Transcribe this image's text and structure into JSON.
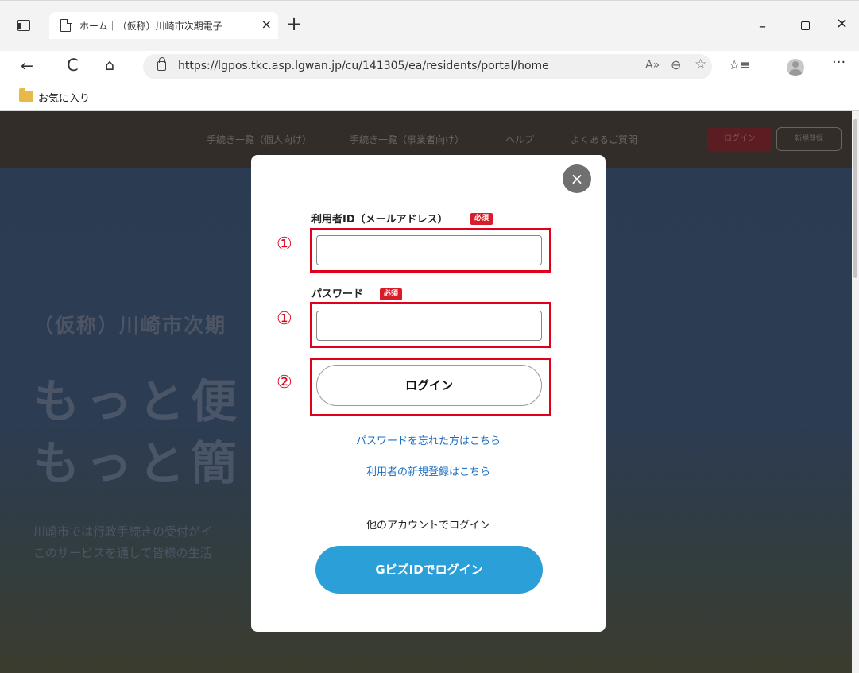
{
  "browser": {
    "tab_title": "ホーム｜（仮称）川崎市次期電子",
    "tab_close": "×",
    "new_tab": "+",
    "minimize": "–",
    "close": "×",
    "url": "https://lgpos.tkc.asp.lgwan.jp/cu/141305/ea/residents/portal/home",
    "back": "←",
    "refresh": "C",
    "home": "⌂",
    "read_aloud": "A»",
    "zoom": "⊖",
    "add_favorite": "☆",
    "favorites": "☆≡",
    "more": "···",
    "favorites_bar_label": "お気に入り"
  },
  "site_nav": {
    "items": [
      "手続き一覧（個人向け）",
      "手続き一覧（事業者向け）",
      "ヘルプ",
      "よくあるご質問"
    ],
    "login": "ログイン",
    "register": "新規登録"
  },
  "hero": {
    "subtitle": "（仮称）川崎市次期",
    "headline_1": "もっと便",
    "headline_2": "もっと簡",
    "text_1": "川崎市では行政手続きの受付がイ",
    "text_2": "このサービスを通して皆様の生活"
  },
  "modal": {
    "close_icon": "×",
    "user_id_label": "利用者ID（メールアドレス）",
    "required": "必須",
    "password_label": "パスワード",
    "user_id_value": "",
    "password_value": "",
    "login_button": "ログイン",
    "forgot_password": "パスワードを忘れた方はこちら",
    "new_registration": "利用者の新規登録はこちら",
    "other_account": "他のアカウントでログイン",
    "gbiz_button": "GビズIDでログイン"
  },
  "annotations": {
    "marker_1": "①",
    "marker_2": "②",
    "color": "#e0001b"
  }
}
